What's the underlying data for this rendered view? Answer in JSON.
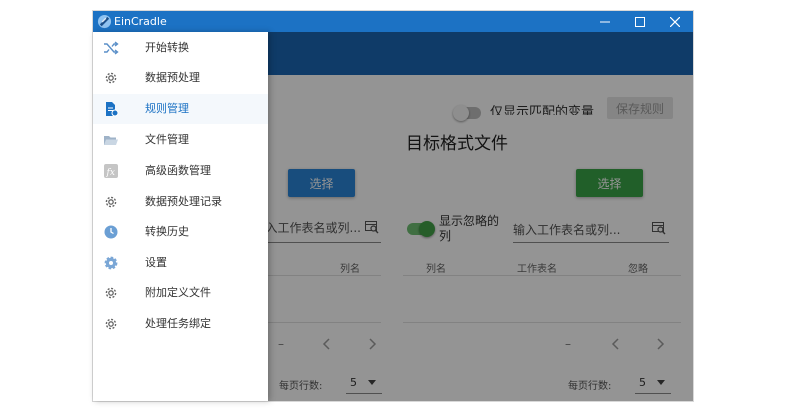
{
  "window": {
    "title": "EinCradle",
    "controls": {
      "minimize": "minimize-icon",
      "maximize": "maximize-icon",
      "close": "close-icon"
    }
  },
  "top_controls": {
    "filter_toggle_label": "仅显示匹配的变量",
    "save_rule_button": "保存规则"
  },
  "main": {
    "title": "目标格式文件"
  },
  "left_pane": {
    "select_button": "选择",
    "search_placeholder": "输入工作表名或列...",
    "column_header": "列名",
    "pagination_dash": "–",
    "rows_per_page_label": "每页行数:",
    "rows_per_page_value": "5"
  },
  "right_pane": {
    "select_button": "选择",
    "show_ignored_label": "显示忽略的列",
    "search_placeholder": "输入工作表名或列...",
    "columns": [
      "列名",
      "工作表名",
      "忽略"
    ],
    "pagination_dash": "–",
    "rows_per_page_label": "每页行数:",
    "rows_per_page_value": "5"
  },
  "colors": {
    "title_bar": "#1c72c4",
    "app_bar": "#1a67b3",
    "primary_button": "#2a86d8",
    "success_button": "#3aa447",
    "active_nav": "#1c72c4"
  },
  "nav": {
    "items": [
      {
        "label": "开始转换",
        "icon": "shuffle-icon"
      },
      {
        "label": "数据预处理",
        "icon": "gear-icon"
      },
      {
        "label": "规则管理",
        "icon": "rule-document-icon",
        "active": true
      },
      {
        "label": "文件管理",
        "icon": "folder-open-icon"
      },
      {
        "label": "高级函数管理",
        "icon": "function-icon"
      },
      {
        "label": "数据预处理记录",
        "icon": "gear-icon"
      },
      {
        "label": "转换历史",
        "icon": "clock-icon"
      },
      {
        "label": "设置",
        "icon": "settings-icon"
      },
      {
        "label": "附加定义文件",
        "icon": "gear-icon"
      },
      {
        "label": "处理任务绑定",
        "icon": "gear-icon"
      }
    ]
  }
}
